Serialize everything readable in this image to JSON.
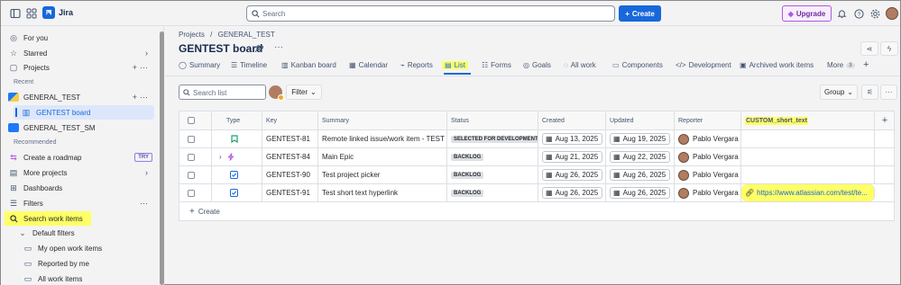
{
  "app": {
    "name": "Jira"
  },
  "topbar": {
    "search_placeholder": "Search",
    "create_label": "Create",
    "upgrade_label": "Upgrade"
  },
  "sidebar": {
    "for_you": "For you",
    "starred": "Starred",
    "projects": "Projects",
    "recent_label": "Recent",
    "project_general_test": "GENERAL_TEST",
    "board_gentest": "GENTEST board",
    "project_general_test_sm": "GENERAL_TEST_SM",
    "recommended_label": "Recommended",
    "create_roadmap": "Create a roadmap",
    "try_badge": "TRY",
    "more_projects": "More projects",
    "dashboards": "Dashboards",
    "filters": "Filters",
    "search_work_items": "Search work items",
    "default_filters": "Default filters",
    "my_open_work_items": "My open work items",
    "reported_by_me": "Reported by me",
    "all_work_items": "All work items"
  },
  "header": {
    "breadcrumb_projects": "Projects",
    "breadcrumb_sep": "/",
    "breadcrumb_project": "GENERAL_TEST",
    "board_title": "GENTEST board"
  },
  "tabs": [
    {
      "label": "Summary"
    },
    {
      "label": "Timeline"
    },
    {
      "label": "Kanban board"
    },
    {
      "label": "Calendar"
    },
    {
      "label": "Reports"
    },
    {
      "label": "List"
    },
    {
      "label": "Forms"
    },
    {
      "label": "Goals"
    },
    {
      "label": "All work"
    },
    {
      "label": "Components"
    },
    {
      "label": "Development"
    },
    {
      "label": "Archived work items"
    },
    {
      "label": "More"
    }
  ],
  "more_count": "3",
  "toolbar": {
    "search_placeholder": "Search list",
    "filter_label": "Filter",
    "group_label": "Group"
  },
  "table": {
    "columns": [
      "Type",
      "Key",
      "Summary",
      "Status",
      "Created",
      "Updated",
      "Reporter",
      "CUSTOM_short_text"
    ],
    "rows": [
      {
        "type": "story",
        "key": "GENTEST-81",
        "summary": "Remote linked issue/work item - TEST",
        "status": "SELECTED FOR DEVELOPMENT",
        "created": "Aug 13, 2025",
        "updated": "Aug 19, 2025",
        "reporter": "Pablo Vergara",
        "custom": ""
      },
      {
        "type": "epic",
        "key": "GENTEST-84",
        "summary": "Main Epic",
        "status": "BACKLOG",
        "created": "Aug 21, 2025",
        "updated": "Aug 22, 2025",
        "reporter": "Pablo Vergara",
        "custom": ""
      },
      {
        "type": "task",
        "key": "GENTEST-90",
        "summary": "Test project picker",
        "status": "BACKLOG",
        "created": "Aug 26, 2025",
        "updated": "Aug 26, 2025",
        "reporter": "Pablo Vergara",
        "custom": ""
      },
      {
        "type": "task",
        "key": "GENTEST-91",
        "summary": "Test short text hyperlink",
        "status": "BACKLOG",
        "created": "Aug 26, 2025",
        "updated": "Aug 26, 2025",
        "reporter": "Pablo Vergara",
        "custom": "https://www.atlassian.com/test/te..."
      }
    ],
    "create_label": "Create"
  },
  "colors": {
    "accent": "#1868db",
    "highlight": "#ffff66",
    "story": "#22a06b",
    "epic": "#af59e1",
    "task": "#1868db"
  }
}
